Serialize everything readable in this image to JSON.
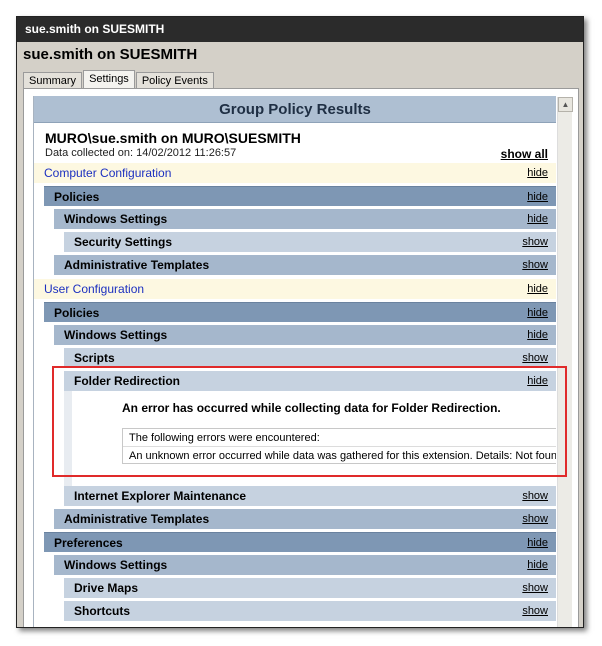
{
  "window": {
    "title": "sue.smith on SUESMITH"
  },
  "header": {
    "title": "sue.smith on SUESMITH"
  },
  "tabs": [
    {
      "label": "Summary"
    },
    {
      "label": "Settings"
    },
    {
      "label": "Policy Events"
    }
  ],
  "report": {
    "title": "Group Policy Results",
    "user_line": "MURO\\sue.smith on MURO\\SUESMITH",
    "data_collected": "Data collected on: 14/02/2012 11:26:57",
    "show_all": "show all"
  },
  "rows": {
    "computer_config": {
      "label": "Computer Configuration",
      "link": "hide"
    },
    "c_policies": {
      "label": "Policies",
      "link": "hide"
    },
    "c_windows_settings": {
      "label": "Windows Settings",
      "link": "hide"
    },
    "c_security_settings": {
      "label": "Security Settings",
      "link": "show"
    },
    "c_admin_templates": {
      "label": "Administrative Templates",
      "link": "show"
    },
    "user_config": {
      "label": "User Configuration",
      "link": "hide"
    },
    "u_policies": {
      "label": "Policies",
      "link": "hide"
    },
    "u_windows_settings": {
      "label": "Windows Settings",
      "link": "hide"
    },
    "u_scripts": {
      "label": "Scripts",
      "link": "show"
    },
    "u_folder_redirection": {
      "label": "Folder Redirection",
      "link": "hide"
    },
    "u_ie_maintenance": {
      "label": "Internet Explorer Maintenance",
      "link": "show"
    },
    "u_admin_templates": {
      "label": "Administrative Templates",
      "link": "show"
    },
    "u_preferences": {
      "label": "Preferences",
      "link": "hide"
    },
    "p_windows_settings": {
      "label": "Windows Settings",
      "link": "hide"
    },
    "p_drive_maps": {
      "label": "Drive Maps",
      "link": "show"
    },
    "p_shortcuts": {
      "label": "Shortcuts",
      "link": "show"
    }
  },
  "error": {
    "title": "An error has occurred while collecting data for Folder Redirection.",
    "line1": "The following errors were encountered:",
    "line2": "An unknown error occurred while data was gathered for this extension. Details: Not found"
  },
  "colors": {
    "highlight": "#e02a2a",
    "category_text": "#1c30c0"
  }
}
